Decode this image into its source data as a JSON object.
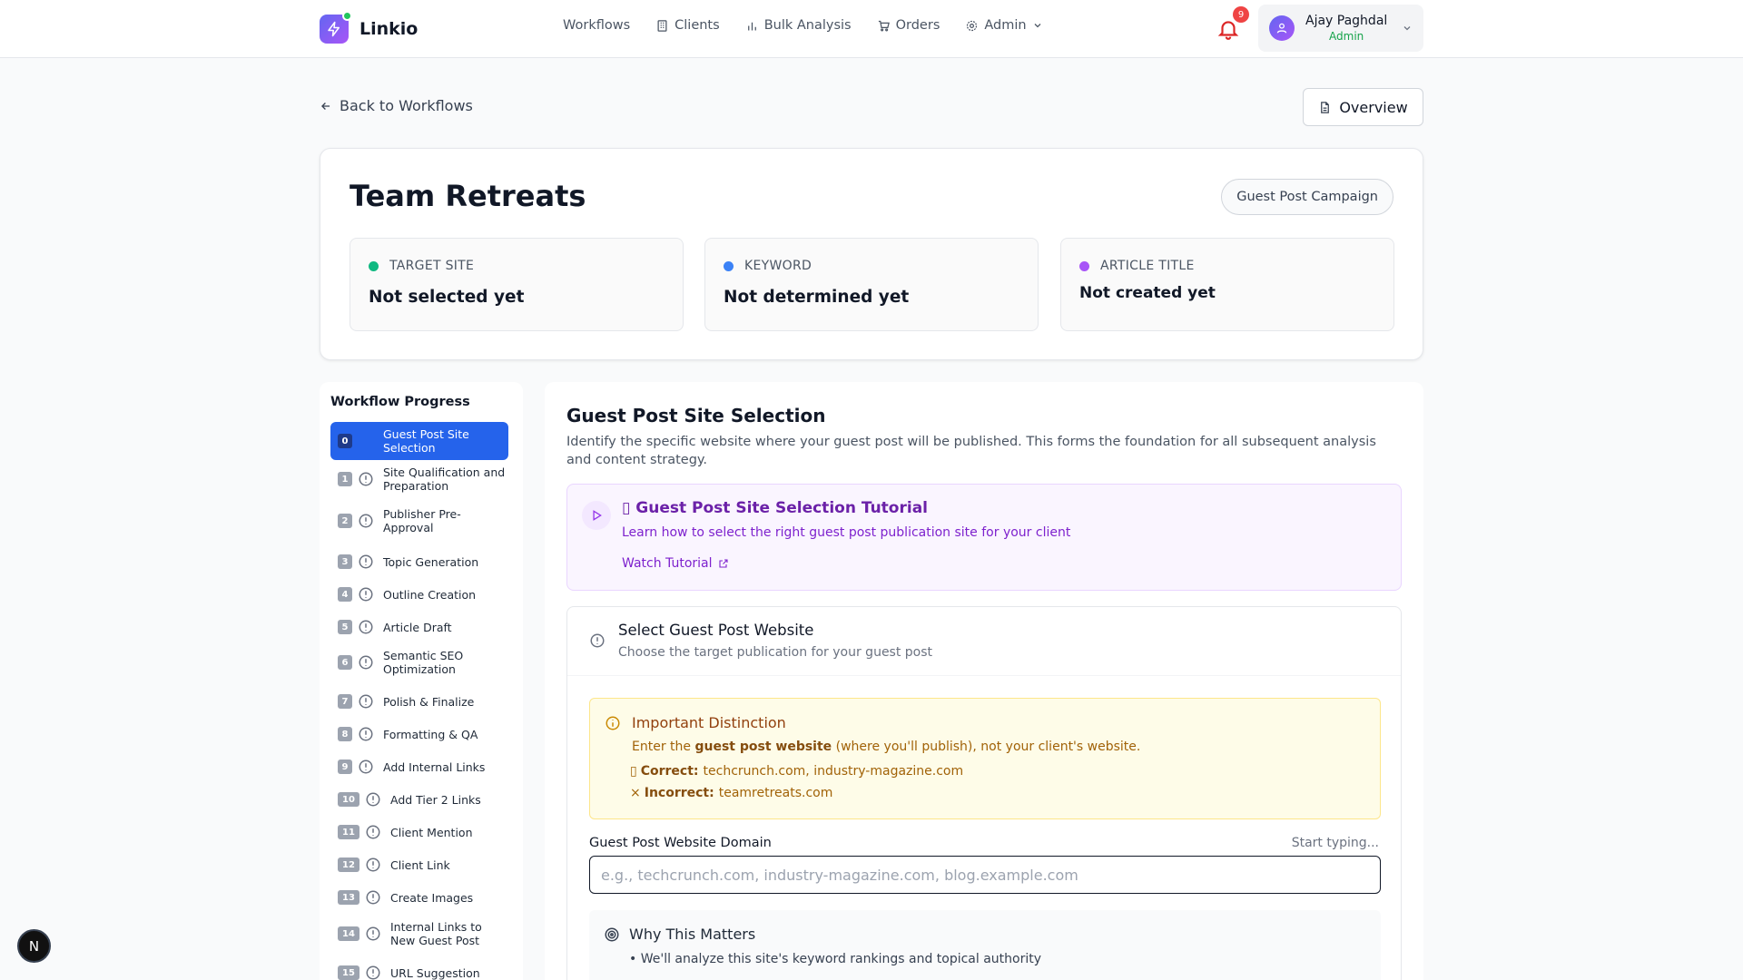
{
  "app": {
    "name": "Linkio"
  },
  "nav": [
    {
      "label": "Workflows",
      "icon": "none"
    },
    {
      "label": "Clients",
      "icon": "building-icon"
    },
    {
      "label": "Bulk Analysis",
      "icon": "bar-chart-icon"
    },
    {
      "label": "Orders",
      "icon": "cart-icon"
    },
    {
      "label": "Admin",
      "icon": "gear-icon"
    }
  ],
  "notifications": {
    "count": "9"
  },
  "user": {
    "name": "Ajay Paghdal",
    "role": "Admin"
  },
  "back_label": "Back to Workflows",
  "overview_label": "Overview",
  "workflow": {
    "title": "Team Retreats",
    "campaign_type": "Guest Post Campaign",
    "info": [
      {
        "label": "TARGET SITE",
        "value": "Not selected yet",
        "color": "#10b981"
      },
      {
        "label": "KEYWORD",
        "value": "Not determined yet",
        "color": "#3b82f6"
      },
      {
        "label": "ARTICLE TITLE",
        "value": "Not created yet",
        "color": "#a855f7"
      }
    ]
  },
  "sidebar": {
    "title": "Workflow Progress",
    "steps": [
      {
        "num": "0",
        "label": "Guest Post Site Selection"
      },
      {
        "num": "1",
        "label": "Site Qualification and Preparation"
      },
      {
        "num": "2",
        "label": "Publisher Pre-Approval"
      },
      {
        "num": "3",
        "label": "Topic Generation"
      },
      {
        "num": "4",
        "label": "Outline Creation"
      },
      {
        "num": "5",
        "label": "Article Draft"
      },
      {
        "num": "6",
        "label": "Semantic SEO Optimization"
      },
      {
        "num": "7",
        "label": "Polish & Finalize"
      },
      {
        "num": "8",
        "label": "Formatting & QA"
      },
      {
        "num": "9",
        "label": "Add Internal Links"
      },
      {
        "num": "10",
        "label": "Add Tier 2 Links"
      },
      {
        "num": "11",
        "label": "Client Mention"
      },
      {
        "num": "12",
        "label": "Client Link"
      },
      {
        "num": "13",
        "label": "Create Images"
      },
      {
        "num": "14",
        "label": "Internal Links to New Guest Post"
      },
      {
        "num": "15",
        "label": "URL Suggestion"
      }
    ]
  },
  "main": {
    "title": "Guest Post Site Selection",
    "description": "Identify the specific website where your guest post will be published. This forms the foundation for all subsequent analysis and content strategy.",
    "tutorial": {
      "title": "Guest Post Site Selection Tutorial",
      "subtitle": "Learn how to select the right guest post publication site for your client",
      "link": "Watch Tutorial"
    },
    "select": {
      "title": "Select Guest Post Website",
      "subtitle": "Choose the target publication for your guest post"
    },
    "distinction": {
      "title": "Important Distinction",
      "text_before": "Enter the",
      "text_bold": "guest post website",
      "text_after": "(where you'll publish), not your client's website.",
      "correct_label": "Correct:",
      "correct_value": "techcrunch.com, industry-magazine.com",
      "incorrect_label": "Incorrect:",
      "incorrect_value": "teamretreats.com"
    },
    "field": {
      "label": "Guest Post Website Domain",
      "hint": "Start typing...",
      "placeholder": "e.g., techcrunch.com, industry-magazine.com, blog.example.com",
      "value": ""
    },
    "why": {
      "title": "Why This Matters",
      "items": [
        "• We'll analyze this site's keyword rankings and topical authority"
      ]
    }
  },
  "dev_badge": "N"
}
